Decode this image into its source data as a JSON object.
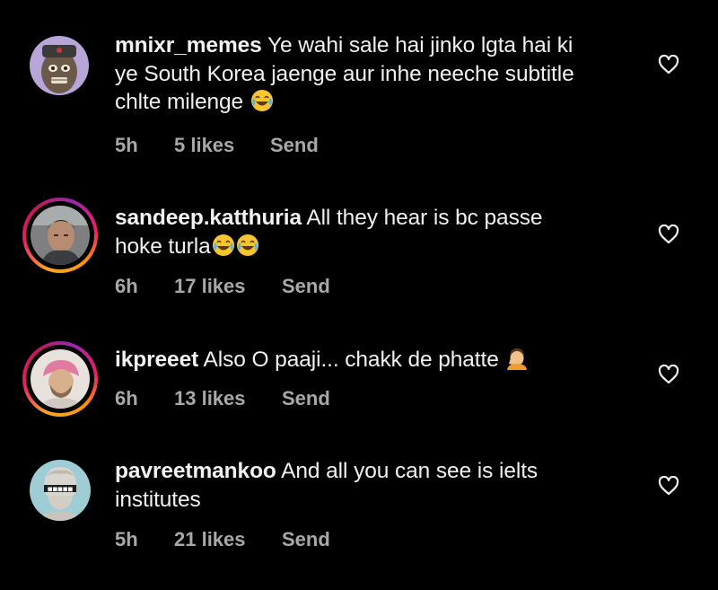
{
  "comments": [
    {
      "username": "mnixr_memes",
      "lines": [
        "Ye wahi sale hai jinko lgta hai ki",
        "ye South Korea jaenge aur inhe neeche subtitle",
        "chlte milenge"
      ],
      "emojis": [
        "face-with-tears-of-joy"
      ],
      "time": "5h",
      "likes": "5 likes",
      "send": "Send",
      "story_ring": false
    },
    {
      "username": "sandeep.katthuria",
      "lines": [
        "All they hear is bc passe",
        "hoke turla"
      ],
      "emojis": [
        "face-with-tears-of-joy",
        "face-with-tears-of-joy"
      ],
      "time": "6h",
      "likes": "17 likes",
      "send": "Send",
      "story_ring": true
    },
    {
      "username": "ikpreeet",
      "lines": [
        "Also O paaji... chakk de phatte"
      ],
      "emojis": [
        "person-facepalming"
      ],
      "time": "6h",
      "likes": "13 likes",
      "send": "Send",
      "story_ring": true
    },
    {
      "username": "pavreetmankoo",
      "lines": [
        "And all you can see is ielts",
        "institutes"
      ],
      "emojis": [],
      "time": "5h",
      "likes": "21 likes",
      "send": "Send",
      "story_ring": false
    }
  ],
  "icons": {
    "like": "heart-outline-icon"
  },
  "colors": {
    "background": "#000000",
    "text": "#f5f5f5",
    "meta": "#a8a8a8",
    "story_ring": [
      "#f9a825",
      "#e91e63",
      "#9c27b0"
    ]
  }
}
